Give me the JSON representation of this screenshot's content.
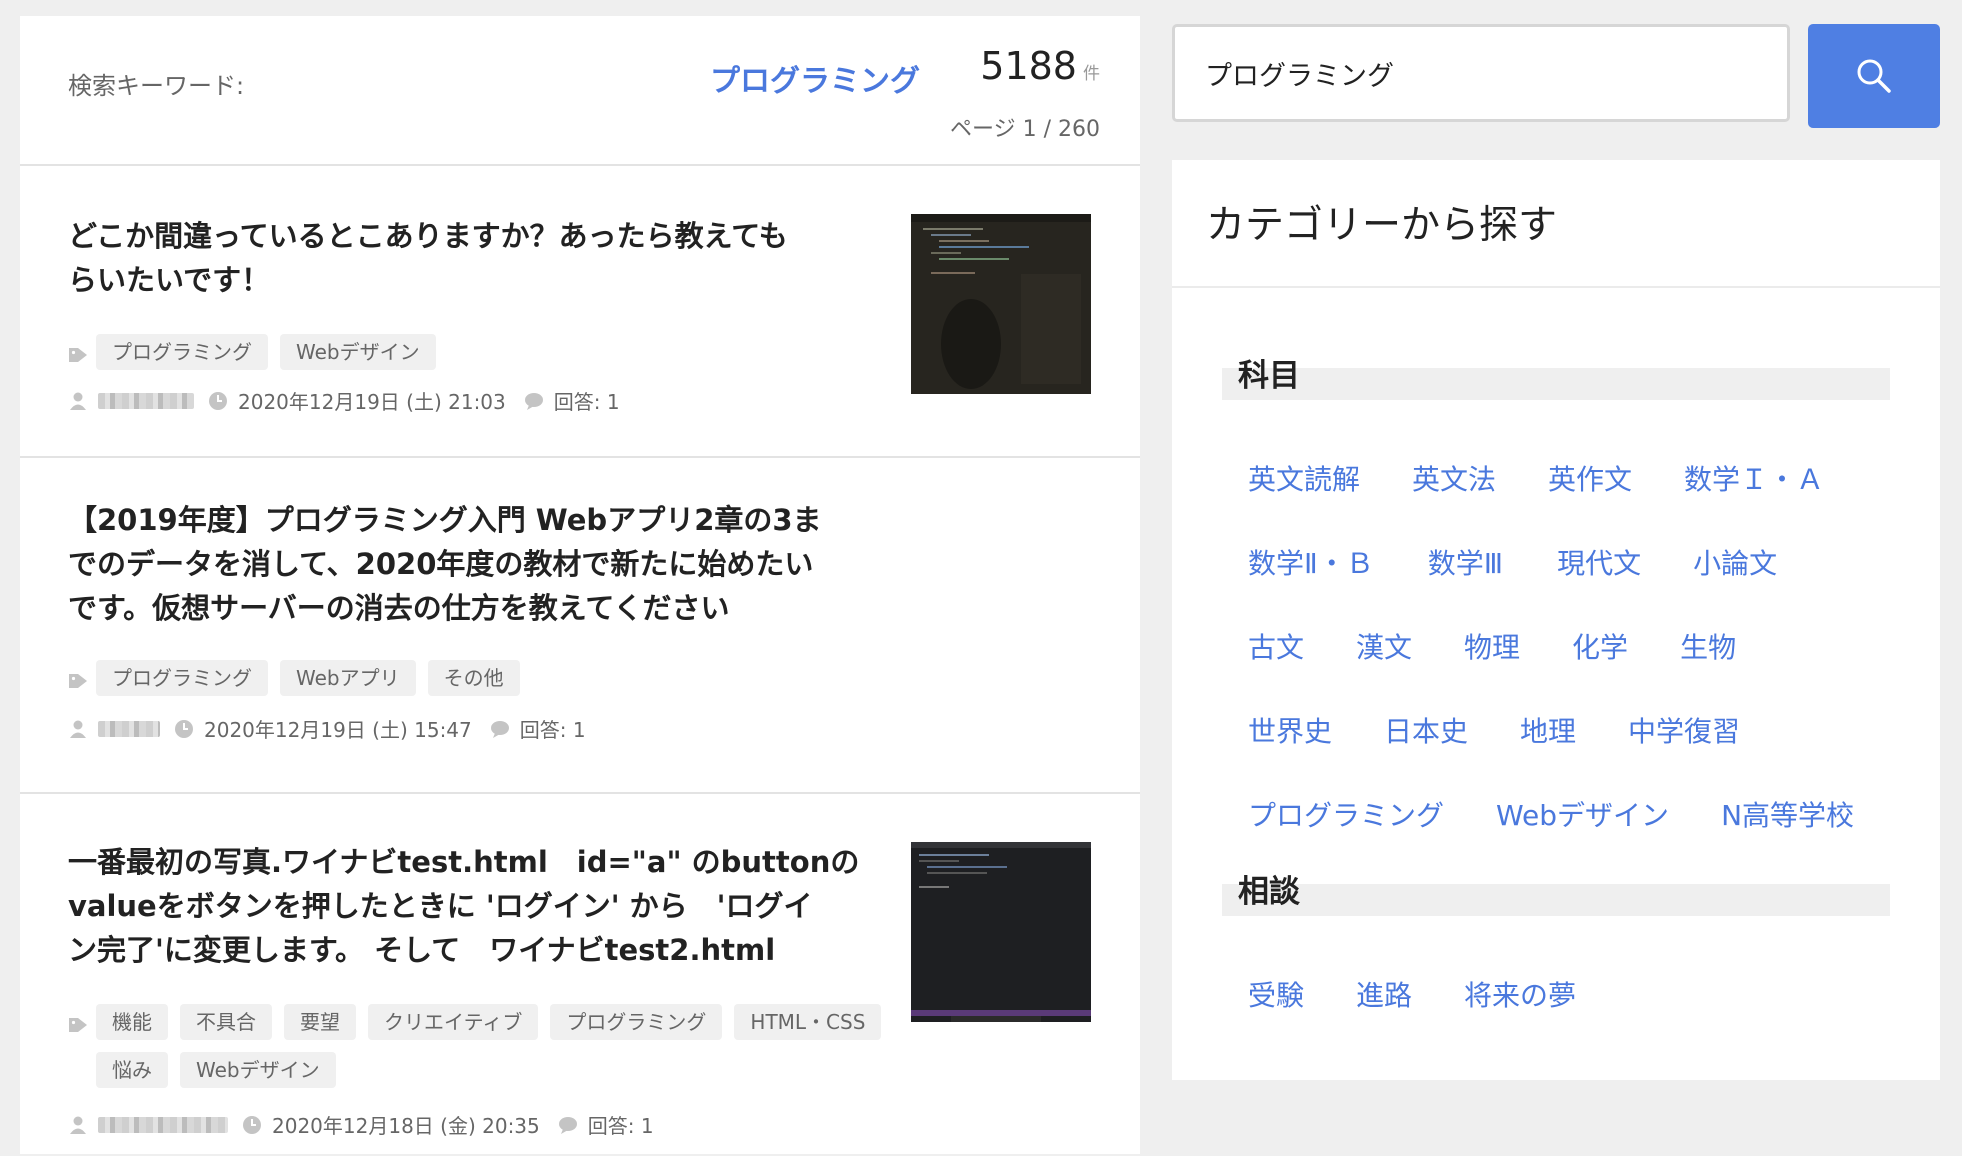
{
  "search": {
    "keyword_label": "検索キーワード:",
    "keyword": "プログラミング",
    "count": "5188",
    "count_unit": "件",
    "page_info": "ページ 1 / 260",
    "input_value": "プログラミング"
  },
  "posts": [
    {
      "title": "どこか間違っているとこありますか？あったら教えても\nらいたいです！",
      "tags": [
        "プログラミング",
        "Webデザイン"
      ],
      "datetime": "2020年12月19日 (土) 21:03",
      "answers": "回答: 1"
    },
    {
      "title": "【2019年度】プログラミング入門 Webアプリ2章の3ま\nでのデータを消して、2020年度の教材で新たに始めたい\nです。仮想サーバーの消去の仕方を教えてください",
      "tags": [
        "プログラミング",
        "Webアプリ",
        "その他"
      ],
      "datetime": "2020年12月19日 (土) 15:47",
      "answers": "回答: 1"
    },
    {
      "title": "一番最初の写真.ワイナビtest.html　id=\"a\" のbuttonの\nvalueをボタンを押したときに 'ログイン' から　'ログイ\nン完了'に変更します。 そして　ワイナビtest2.html",
      "tags": [
        "機能",
        "不具合",
        "要望",
        "クリエイティブ",
        "プログラミング",
        "HTML・CSS",
        "悩み",
        "Webデザイン"
      ],
      "datetime": "2020年12月18日 (金) 20:35",
      "answers": "回答: 1"
    }
  ],
  "categories": {
    "title": "カテゴリーから探す",
    "groups": [
      {
        "name": "科目",
        "rows": [
          [
            "英文読解",
            "英文法",
            "英作文",
            "数学Ｉ・Ａ"
          ],
          [
            "数学Ⅱ・Ｂ",
            "数学Ⅲ",
            "現代文",
            "小論文"
          ],
          [
            "古文",
            "漢文",
            "物理",
            "化学",
            "生物"
          ],
          [
            "世界史",
            "日本史",
            "地理",
            "中学復習"
          ],
          [
            "プログラミング",
            "Webデザイン",
            "N高等学校"
          ]
        ]
      },
      {
        "name": "相談",
        "rows": [
          [
            "受験",
            "進路",
            "将来の夢"
          ]
        ]
      }
    ]
  },
  "colors": {
    "accent": "#4a78dd",
    "button": "#4f7fe3"
  },
  "icons": {
    "search": "magnifier-icon",
    "tag": "tag-icon",
    "user": "user-icon",
    "time": "clock-icon",
    "comment": "comment-icon"
  }
}
